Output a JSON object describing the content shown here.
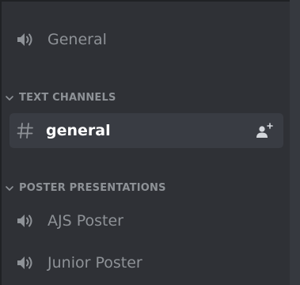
{
  "voice_top": {
    "label": "General",
    "icon": "speaker-icon"
  },
  "text_category": {
    "label": "TEXT CHANNELS",
    "icon": "chevron-down-icon"
  },
  "text_channels": [
    {
      "label": "general",
      "icon": "hash-icon",
      "prefix": "#",
      "active": true,
      "action_icon": "add-member-icon"
    }
  ],
  "poster_category": {
    "label": "POSTER PRESENTATIONS",
    "icon": "chevron-down-icon"
  },
  "poster_channels": [
    {
      "label": "AJS Poster",
      "icon": "speaker-icon"
    },
    {
      "label": "Junior Poster",
      "icon": "speaker-icon"
    }
  ],
  "colors": {
    "sidebar_bg": "#2f3136",
    "active_bg": "#393c43",
    "muted_text": "#8e9297",
    "active_text": "#ffffff"
  }
}
